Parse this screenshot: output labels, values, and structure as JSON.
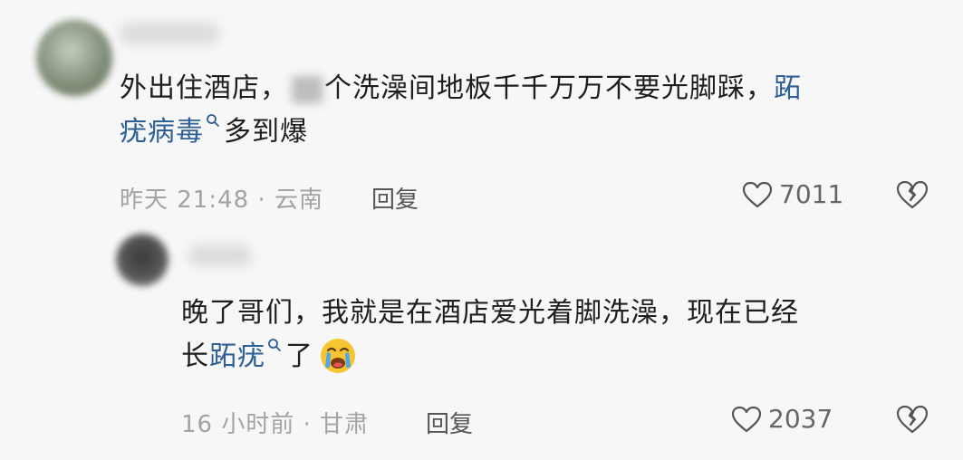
{
  "comments": [
    {
      "text_part1": "外出住酒店，",
      "text_part2": "个洗澡间地板千千万万不要光脚踩，",
      "keyword_line1": "跖",
      "keyword_line2": "疣病毒",
      "text_part3": "多到爆",
      "meta": "昨天 21:48 · 云南",
      "reply_label": "回复",
      "likes": "7011"
    },
    {
      "line1": "晚了哥们，我就是在酒店爱光着脚洗澡，现在已经",
      "line2_prefix": "长",
      "keyword": "跖疣",
      "line2_suffix": "了",
      "meta": "16 小时前 · 甘肃",
      "reply_label": "回复",
      "likes": "2037"
    }
  ],
  "colors": {
    "keyword": "#2f5f97",
    "meta": "#a3a3a3",
    "background": "#f7f7f7"
  },
  "icons": [
    "search-icon",
    "heart-icon",
    "broken-heart-icon",
    "crying-emoji-icon"
  ]
}
